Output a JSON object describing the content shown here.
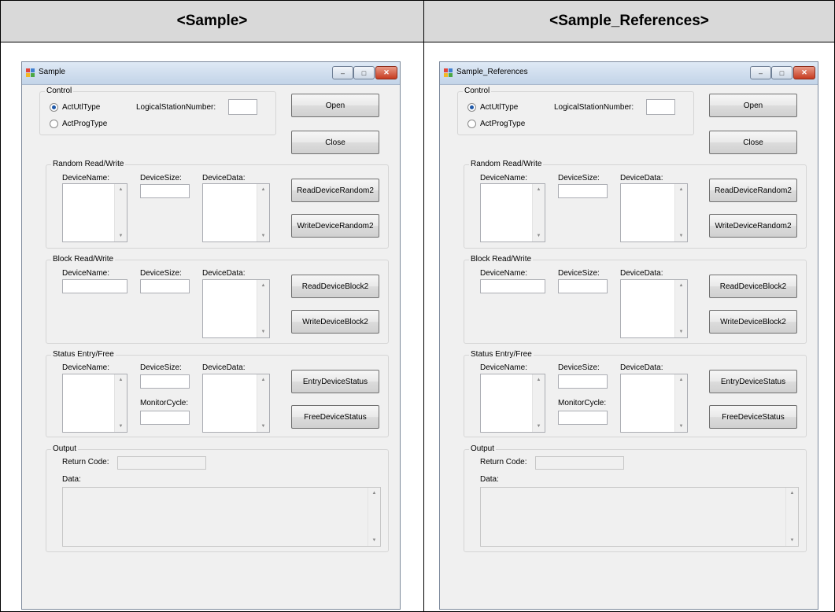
{
  "headers": {
    "left": "<Sample>",
    "right": "<Sample_References>"
  },
  "windows": [
    {
      "title": "Sample"
    },
    {
      "title": "Sample_References"
    }
  ],
  "titlebar": {
    "minimize": "–",
    "maximize": "□",
    "close": "✕"
  },
  "control": {
    "group": "Control",
    "radio1": "ActUtlType",
    "radio2": "ActProgType",
    "station_label": "LogicalStationNumber:",
    "station_value": "",
    "open": "Open",
    "close": "Close"
  },
  "random": {
    "group": "Random Read/Write",
    "device_name": "DeviceName:",
    "device_size": "DeviceSize:",
    "device_data": "DeviceData:",
    "read": "ReadDeviceRandom2",
    "write": "WriteDeviceRandom2"
  },
  "block": {
    "group": "Block Read/Write",
    "device_name": "DeviceName:",
    "device_size": "DeviceSize:",
    "device_data": "DeviceData:",
    "read": "ReadDeviceBlock2",
    "write": "WriteDeviceBlock2"
  },
  "status": {
    "group": "Status Entry/Free",
    "device_name": "DeviceName:",
    "device_size": "DeviceSize:",
    "device_data": "DeviceData:",
    "monitor_cycle": "MonitorCycle:",
    "entry": "EntryDeviceStatus",
    "free": "FreeDeviceStatus"
  },
  "output": {
    "group": "Output",
    "return_code": "Return Code:",
    "data": "Data:"
  },
  "colors": {
    "header_bg": "#d9d9d9",
    "window_bg": "#f0f0f0",
    "close_btn": "#c63b20",
    "radio_dot": "#1e58a8"
  }
}
